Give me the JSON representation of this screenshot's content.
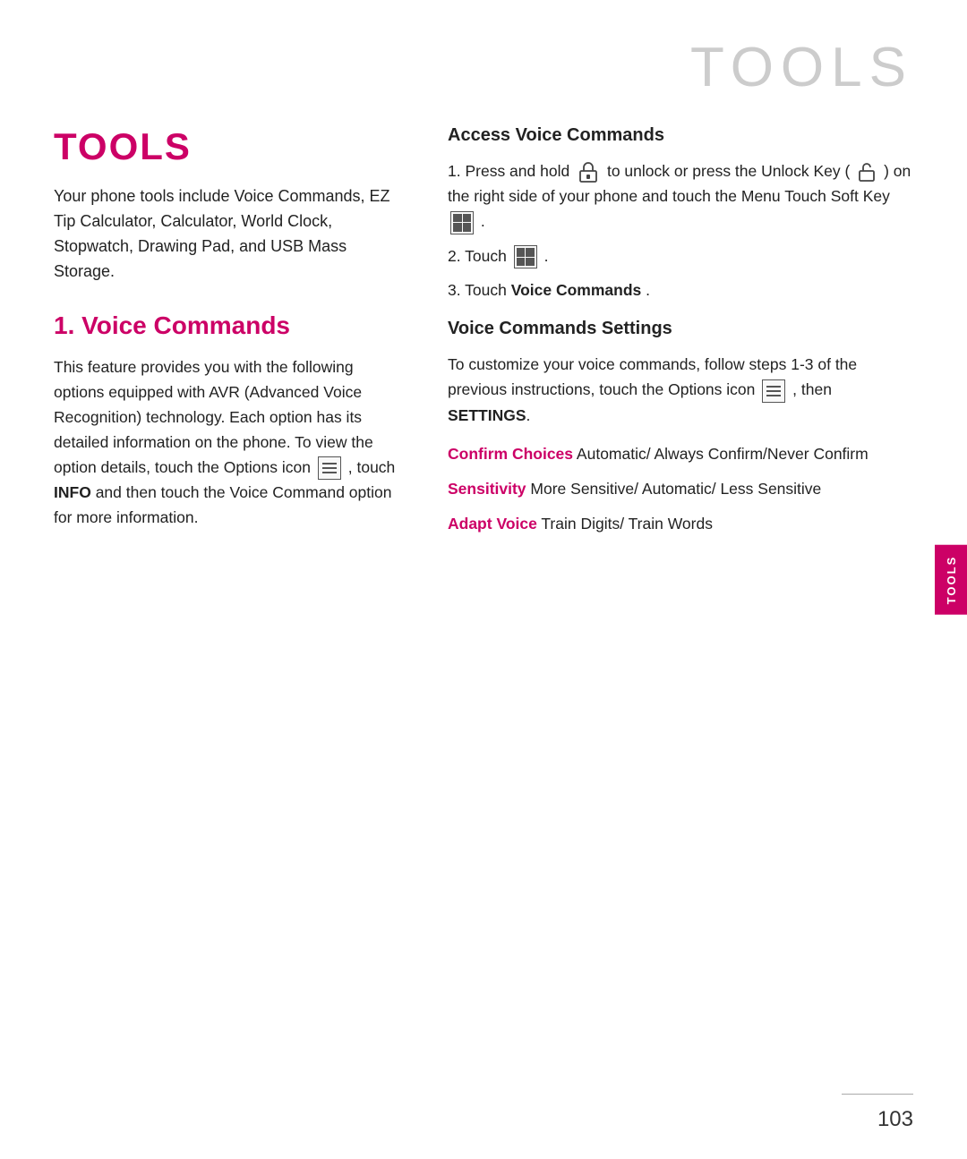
{
  "header": {
    "title": "TOOLS"
  },
  "sideTab": {
    "label": "TOOLS"
  },
  "leftCol": {
    "mainTitle": "TOOLS",
    "introText": "Your phone tools include Voice Commands, EZ Tip Calculator, Calculator, World Clock, Stopwatch, Drawing Pad, and USB Mass Storage.",
    "subHeading": "1. Voice Commands",
    "bodyText1": "This feature provides you with the following options equipped with AVR (Advanced Voice Recognition) technology. Each option has its detailed information on the phone. To view the option details, touch the Options icon",
    "bodyText2": ", touch",
    "bodyTextINFO": "INFO",
    "bodyText3": "and then touch the Voice Command option for more information."
  },
  "rightCol": {
    "accessTitle": "Access Voice Commands",
    "step1a": "1. Press and hold",
    "step1b": "to unlock or press the Unlock Key (",
    "step1c": ") on the right side of your phone and touch the Menu Touch Soft Key",
    "step1d": ".",
    "step2a": "2. Touch",
    "step2b": ".",
    "step3a": "3. Touch",
    "step3bold": "Voice Commands",
    "step3b": ".",
    "settingsTitle": "Voice Commands Settings",
    "settingsIntro": "To customize your voice commands, follow steps 1-3 of the previous instructions, touch the Options icon",
    "settingsEnd": ", then",
    "settingsBold": "SETTINGS",
    "settingsPeriod": ".",
    "confirmLabel": "Confirm Choices",
    "confirmOptions": "  Automatic/ Always Confirm/Never Confirm",
    "sensitivityLabel": "Sensitivity",
    "sensitivityOptions": "  More Sensitive/ Automatic/ Less Sensitive",
    "adaptLabel": "Adapt Voice",
    "adaptOptions": "  Train Digits/ Train Words"
  },
  "footer": {
    "pageNumber": "103"
  }
}
